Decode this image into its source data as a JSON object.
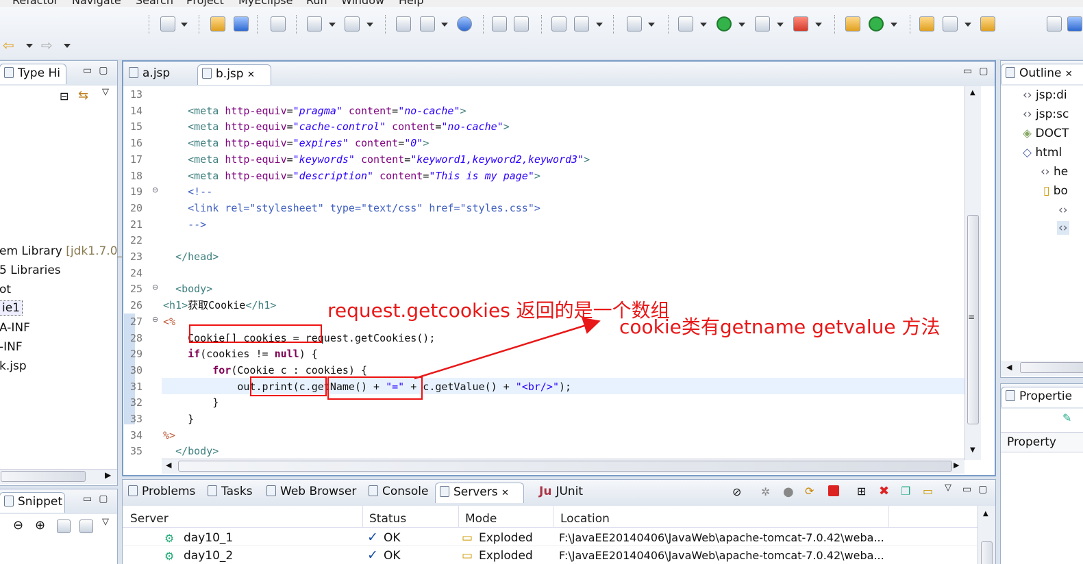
{
  "menu": [
    "Refactor",
    "Navigate",
    "Search",
    "Project",
    "MyEclipse",
    "Run",
    "Window",
    "Help"
  ],
  "left_panel": {
    "title": "Type Hi",
    "tree": [
      "em Library ",
      "5 Libraries",
      "ot",
      "ie1",
      "A-INF",
      "-INF",
      "k.jsp"
    ],
    "jdk_suffix": "[jdk1.7.0_(",
    "snippet_title": "Snippet"
  },
  "editor": {
    "tabs": [
      "a.jsp",
      "b.jsp"
    ],
    "lines": [
      {
        "n": "13",
        "html": ""
      },
      {
        "n": "14",
        "html": "    <span class='tg'>&lt;meta</span> <span class='at'>http-equiv</span>=<span class='av'>\"pragma\"</span> <span class='at'>content</span>=<span class='av'>\"no-cache\"</span><span class='tg'>&gt;</span>"
      },
      {
        "n": "15",
        "html": "    <span class='tg'>&lt;meta</span> <span class='at'>http-equiv</span>=<span class='av'>\"cache-control\"</span> <span class='at'>content</span>=<span class='av'>\"no-cache\"</span><span class='tg'>&gt;</span>"
      },
      {
        "n": "16",
        "html": "    <span class='tg'>&lt;meta</span> <span class='at'>http-equiv</span>=<span class='av'>\"expires\"</span> <span class='at'>content</span>=<span class='av'>\"0\"</span><span class='tg'>&gt;</span>"
      },
      {
        "n": "17",
        "html": "    <span class='tg'>&lt;meta</span> <span class='at'>http-equiv</span>=<span class='av'>\"keywords\"</span> <span class='at'>content</span>=<span class='av'>\"keyword1,keyword2,keyword3\"</span><span class='tg'>&gt;</span>"
      },
      {
        "n": "18",
        "html": "    <span class='tg'>&lt;meta</span> <span class='at'>http-equiv</span>=<span class='av'>\"description\"</span> <span class='at'>content</span>=<span class='av'>\"This is my page\"</span><span class='tg'>&gt;</span>"
      },
      {
        "n": "19",
        "html": "    <span class='cm'>&lt;!--</span>"
      },
      {
        "n": "20",
        "html": "    <span class='cm'>&lt;link rel=\"stylesheet\" type=\"text/css\" href=\"styles.css\"&gt;</span>"
      },
      {
        "n": "21",
        "html": "    <span class='cm'>--&gt;</span>"
      },
      {
        "n": "22",
        "html": ""
      },
      {
        "n": "23",
        "html": "  <span class='tg'>&lt;/head&gt;</span>"
      },
      {
        "n": "24",
        "html": ""
      },
      {
        "n": "25",
        "html": "  <span class='tg'>&lt;body&gt;</span>"
      },
      {
        "n": "26",
        "html": "<span class='tg'>&lt;h1&gt;</span>获取Cookie<span class='tg'>&lt;/h1&gt;</span>"
      },
      {
        "n": "27",
        "html": "<span class='jsp'>&lt;%</span>"
      },
      {
        "n": "28",
        "html": "    Cookie[] cookies = request.getCookies();"
      },
      {
        "n": "29",
        "html": "    <span class='kw'>if</span>(cookies != <span class='kw'>null</span>) {"
      },
      {
        "n": "30",
        "html": "        <span class='kw'>for</span>(Cookie c : cookies) {"
      },
      {
        "n": "31",
        "html": "            out.print(c.getName() + <span class='st'>\"=\"</span> + c.getValue() + <span class='st'>\"&lt;br/&gt;\"</span>);"
      },
      {
        "n": "32",
        "html": "        }"
      },
      {
        "n": "33",
        "html": "    }"
      },
      {
        "n": "34",
        "html": "<span class='jsp'>%&gt;</span>"
      },
      {
        "n": "35",
        "html": "  <span class='tg'>&lt;/body&gt;</span>"
      }
    ]
  },
  "annotations": {
    "note1": "request.getcookies 返回的是一个数组",
    "note2": "cookie类有getname   getvalue 方法"
  },
  "outline": {
    "title": "Outline",
    "items": [
      "jsp:di",
      "jsp:sc",
      "DOCT",
      "html",
      "he",
      "bo",
      "",
      ""
    ]
  },
  "properties": {
    "title": "Propertie",
    "column": "Property"
  },
  "bottom": {
    "tabs": [
      "Problems",
      "Tasks",
      "Web Browser",
      "Console",
      "Servers",
      "JUnit"
    ],
    "headers": [
      "Server",
      "Status",
      "Mode",
      "Location"
    ],
    "rows": [
      {
        "server": "day10_1",
        "status": "OK",
        "mode": "Exploded",
        "location": "F:\\JavaEE20140406\\JavaWeb\\apache-tomcat-7.0.42\\weba..."
      },
      {
        "server": "day10_2",
        "status": "OK",
        "mode": "Exploded",
        "location": "F:\\JavaEE20140406\\JavaWeb\\apache-tomcat-7.0.42\\weba..."
      }
    ]
  },
  "colors": {
    "accent_red": "#e81818",
    "tag": "#3f7f7f",
    "attr": "#7f007f",
    "value": "#2a00ff",
    "keyword": "#7f0055"
  }
}
